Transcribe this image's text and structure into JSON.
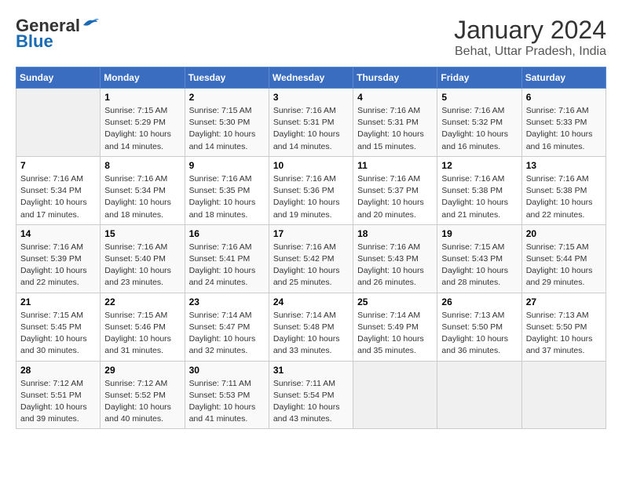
{
  "header": {
    "logo_general": "General",
    "logo_blue": "Blue",
    "title": "January 2024",
    "subtitle": "Behat, Uttar Pradesh, India"
  },
  "days_of_week": [
    "Sunday",
    "Monday",
    "Tuesday",
    "Wednesday",
    "Thursday",
    "Friday",
    "Saturday"
  ],
  "weeks": [
    [
      {
        "day": "",
        "sunrise": "",
        "sunset": "",
        "daylight": ""
      },
      {
        "day": "1",
        "sunrise": "Sunrise: 7:15 AM",
        "sunset": "Sunset: 5:29 PM",
        "daylight": "Daylight: 10 hours and 14 minutes."
      },
      {
        "day": "2",
        "sunrise": "Sunrise: 7:15 AM",
        "sunset": "Sunset: 5:30 PM",
        "daylight": "Daylight: 10 hours and 14 minutes."
      },
      {
        "day": "3",
        "sunrise": "Sunrise: 7:16 AM",
        "sunset": "Sunset: 5:31 PM",
        "daylight": "Daylight: 10 hours and 14 minutes."
      },
      {
        "day": "4",
        "sunrise": "Sunrise: 7:16 AM",
        "sunset": "Sunset: 5:31 PM",
        "daylight": "Daylight: 10 hours and 15 minutes."
      },
      {
        "day": "5",
        "sunrise": "Sunrise: 7:16 AM",
        "sunset": "Sunset: 5:32 PM",
        "daylight": "Daylight: 10 hours and 16 minutes."
      },
      {
        "day": "6",
        "sunrise": "Sunrise: 7:16 AM",
        "sunset": "Sunset: 5:33 PM",
        "daylight": "Daylight: 10 hours and 16 minutes."
      }
    ],
    [
      {
        "day": "7",
        "sunrise": "Sunrise: 7:16 AM",
        "sunset": "Sunset: 5:34 PM",
        "daylight": "Daylight: 10 hours and 17 minutes."
      },
      {
        "day": "8",
        "sunrise": "Sunrise: 7:16 AM",
        "sunset": "Sunset: 5:34 PM",
        "daylight": "Daylight: 10 hours and 18 minutes."
      },
      {
        "day": "9",
        "sunrise": "Sunrise: 7:16 AM",
        "sunset": "Sunset: 5:35 PM",
        "daylight": "Daylight: 10 hours and 18 minutes."
      },
      {
        "day": "10",
        "sunrise": "Sunrise: 7:16 AM",
        "sunset": "Sunset: 5:36 PM",
        "daylight": "Daylight: 10 hours and 19 minutes."
      },
      {
        "day": "11",
        "sunrise": "Sunrise: 7:16 AM",
        "sunset": "Sunset: 5:37 PM",
        "daylight": "Daylight: 10 hours and 20 minutes."
      },
      {
        "day": "12",
        "sunrise": "Sunrise: 7:16 AM",
        "sunset": "Sunset: 5:38 PM",
        "daylight": "Daylight: 10 hours and 21 minutes."
      },
      {
        "day": "13",
        "sunrise": "Sunrise: 7:16 AM",
        "sunset": "Sunset: 5:38 PM",
        "daylight": "Daylight: 10 hours and 22 minutes."
      }
    ],
    [
      {
        "day": "14",
        "sunrise": "Sunrise: 7:16 AM",
        "sunset": "Sunset: 5:39 PM",
        "daylight": "Daylight: 10 hours and 22 minutes."
      },
      {
        "day": "15",
        "sunrise": "Sunrise: 7:16 AM",
        "sunset": "Sunset: 5:40 PM",
        "daylight": "Daylight: 10 hours and 23 minutes."
      },
      {
        "day": "16",
        "sunrise": "Sunrise: 7:16 AM",
        "sunset": "Sunset: 5:41 PM",
        "daylight": "Daylight: 10 hours and 24 minutes."
      },
      {
        "day": "17",
        "sunrise": "Sunrise: 7:16 AM",
        "sunset": "Sunset: 5:42 PM",
        "daylight": "Daylight: 10 hours and 25 minutes."
      },
      {
        "day": "18",
        "sunrise": "Sunrise: 7:16 AM",
        "sunset": "Sunset: 5:43 PM",
        "daylight": "Daylight: 10 hours and 26 minutes."
      },
      {
        "day": "19",
        "sunrise": "Sunrise: 7:15 AM",
        "sunset": "Sunset: 5:43 PM",
        "daylight": "Daylight: 10 hours and 28 minutes."
      },
      {
        "day": "20",
        "sunrise": "Sunrise: 7:15 AM",
        "sunset": "Sunset: 5:44 PM",
        "daylight": "Daylight: 10 hours and 29 minutes."
      }
    ],
    [
      {
        "day": "21",
        "sunrise": "Sunrise: 7:15 AM",
        "sunset": "Sunset: 5:45 PM",
        "daylight": "Daylight: 10 hours and 30 minutes."
      },
      {
        "day": "22",
        "sunrise": "Sunrise: 7:15 AM",
        "sunset": "Sunset: 5:46 PM",
        "daylight": "Daylight: 10 hours and 31 minutes."
      },
      {
        "day": "23",
        "sunrise": "Sunrise: 7:14 AM",
        "sunset": "Sunset: 5:47 PM",
        "daylight": "Daylight: 10 hours and 32 minutes."
      },
      {
        "day": "24",
        "sunrise": "Sunrise: 7:14 AM",
        "sunset": "Sunset: 5:48 PM",
        "daylight": "Daylight: 10 hours and 33 minutes."
      },
      {
        "day": "25",
        "sunrise": "Sunrise: 7:14 AM",
        "sunset": "Sunset: 5:49 PM",
        "daylight": "Daylight: 10 hours and 35 minutes."
      },
      {
        "day": "26",
        "sunrise": "Sunrise: 7:13 AM",
        "sunset": "Sunset: 5:50 PM",
        "daylight": "Daylight: 10 hours and 36 minutes."
      },
      {
        "day": "27",
        "sunrise": "Sunrise: 7:13 AM",
        "sunset": "Sunset: 5:50 PM",
        "daylight": "Daylight: 10 hours and 37 minutes."
      }
    ],
    [
      {
        "day": "28",
        "sunrise": "Sunrise: 7:12 AM",
        "sunset": "Sunset: 5:51 PM",
        "daylight": "Daylight: 10 hours and 39 minutes."
      },
      {
        "day": "29",
        "sunrise": "Sunrise: 7:12 AM",
        "sunset": "Sunset: 5:52 PM",
        "daylight": "Daylight: 10 hours and 40 minutes."
      },
      {
        "day": "30",
        "sunrise": "Sunrise: 7:11 AM",
        "sunset": "Sunset: 5:53 PM",
        "daylight": "Daylight: 10 hours and 41 minutes."
      },
      {
        "day": "31",
        "sunrise": "Sunrise: 7:11 AM",
        "sunset": "Sunset: 5:54 PM",
        "daylight": "Daylight: 10 hours and 43 minutes."
      },
      {
        "day": "",
        "sunrise": "",
        "sunset": "",
        "daylight": ""
      },
      {
        "day": "",
        "sunrise": "",
        "sunset": "",
        "daylight": ""
      },
      {
        "day": "",
        "sunrise": "",
        "sunset": "",
        "daylight": ""
      }
    ]
  ]
}
